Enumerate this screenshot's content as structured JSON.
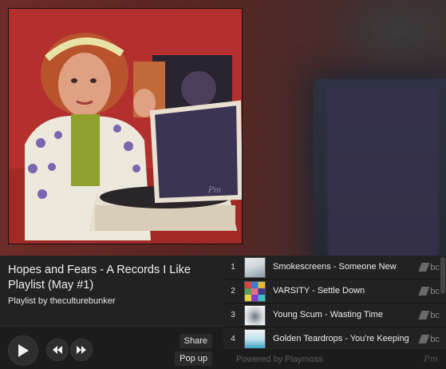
{
  "playlist": {
    "title": "Hopes and Fears - A Records I Like Playlist (May #1)",
    "byline": "Playlist by theculturebunker"
  },
  "controls": {
    "play_icon": "play-icon",
    "prev_icon": "previous-icon",
    "next_icon": "next-icon",
    "share_label": "Share",
    "popup_label": "Pop up"
  },
  "tracks": [
    {
      "num": "1",
      "name": "Smokescreens - Someone New",
      "source": "bc"
    },
    {
      "num": "2",
      "name": "VARSITY - Settle Down",
      "source": "bc"
    },
    {
      "num": "3",
      "name": "Young Scum - Wasting Time",
      "source": "bc"
    },
    {
      "num": "4",
      "name": "Golden Teardrops - You're Keeping",
      "source": "bc"
    }
  ],
  "footer": {
    "powered_prefix": "Powered by ",
    "powered_brand": "Playmoss",
    "logo": "Pm"
  },
  "colors": {
    "background": "#1a1a1a",
    "panel": "#222222",
    "text": "#f0f0f0",
    "muted": "#5e5e5e"
  }
}
